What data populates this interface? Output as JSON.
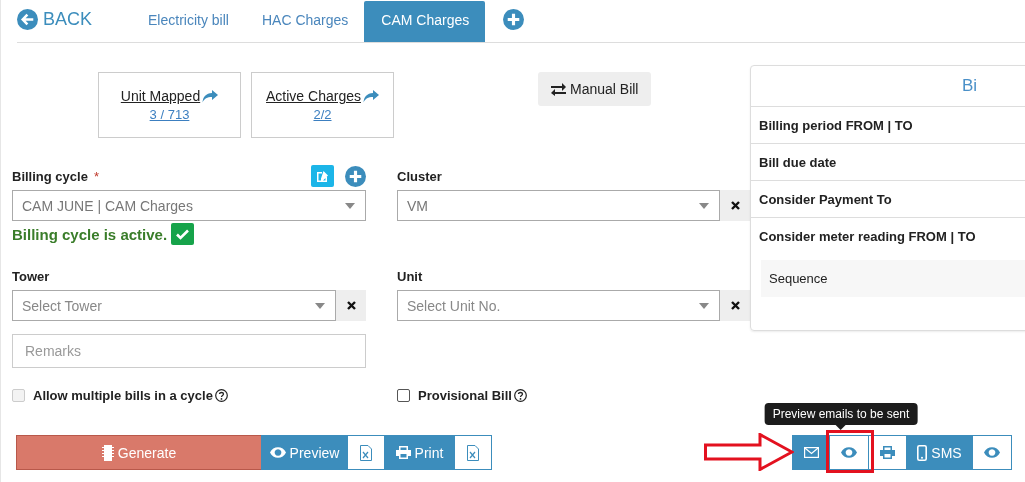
{
  "back": {
    "label": "BACK"
  },
  "tabs": [
    {
      "label": "Electricity bill",
      "selected": false
    },
    {
      "label": "HAC Charges",
      "selected": false
    },
    {
      "label": "CAM Charges",
      "selected": true
    }
  ],
  "stats": [
    {
      "label": "Unit Mapped",
      "value": "3 / 713"
    },
    {
      "label": "Active Charges",
      "value": "2/2"
    }
  ],
  "manual_bill": {
    "label": "Manual Bill"
  },
  "fields": [
    {
      "label": "Billing cycle",
      "required_mark": "*",
      "kind": "select",
      "value": "CAM JUNE | CAM Charges",
      "clearable": false,
      "has_tools": true
    },
    {
      "label": "Cluster",
      "kind": "select",
      "value": "VM",
      "clearable": true,
      "has_tools": false
    },
    {
      "label": "Tower",
      "kind": "select",
      "placeholder": "Select Tower",
      "clearable": true,
      "has_tools": false
    },
    {
      "label": "Unit",
      "kind": "select",
      "placeholder": "Select Unit No.",
      "clearable": true,
      "has_tools": false
    },
    {
      "kind": "text",
      "placeholder": "Remarks",
      "clearable": false
    }
  ],
  "status": {
    "text": "Billing cycle is active.",
    "active": true
  },
  "checkboxes": [
    {
      "label": "Allow multiple bills in a cycle",
      "checked": false,
      "disabled": true
    },
    {
      "label": "Provisional Bill",
      "checked": false,
      "disabled": false
    }
  ],
  "panel": {
    "title": "Bi",
    "rows": [
      "Billing period FROM | TO",
      "Bill due date",
      "Consider Payment To",
      "Consider meter reading FROM | TO"
    ],
    "sequence": "Sequence"
  },
  "actions_left": [
    {
      "kind": "generate",
      "label": "Generate"
    },
    {
      "kind": "preview",
      "label": "Preview"
    },
    {
      "kind": "export"
    },
    {
      "kind": "print",
      "label": "Print"
    },
    {
      "kind": "export"
    }
  ],
  "actions_right": [
    {
      "kind": "email",
      "highlighted": false
    },
    {
      "kind": "preview",
      "highlighted": true,
      "tooltip": "Preview emails to be sent"
    },
    {
      "kind": "print",
      "highlighted": false
    },
    {
      "kind": "sms",
      "label": "SMS",
      "highlighted": false
    },
    {
      "kind": "preview",
      "highlighted": false
    }
  ]
}
